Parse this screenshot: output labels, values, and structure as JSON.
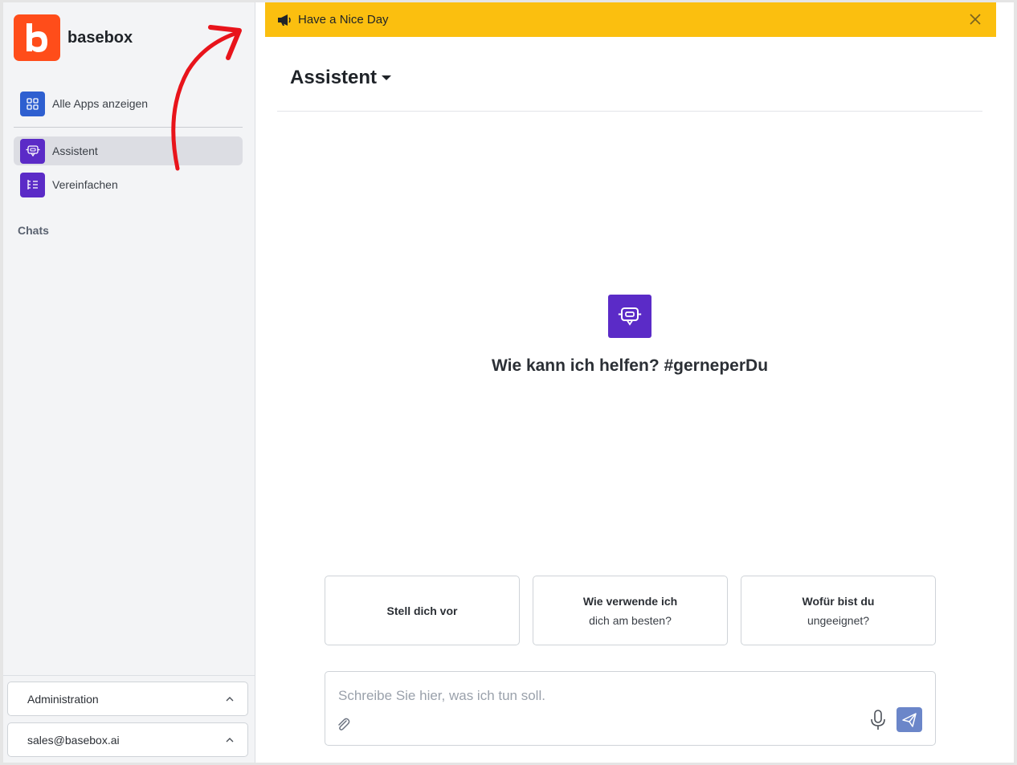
{
  "brand": {
    "name": "basebox",
    "logo_letter": "b"
  },
  "sidebar": {
    "items": [
      {
        "label": "Alle Apps anzeigen",
        "icon": "grid-icon"
      },
      {
        "label": "Assistent",
        "icon": "robot-icon",
        "active": true
      },
      {
        "label": "Vereinfachen",
        "icon": "list-indent-icon"
      }
    ],
    "chats_label": "Chats",
    "admin_label": "Administration",
    "account_label": "sales@basebox.ai"
  },
  "banner": {
    "text": "Have a Nice Day",
    "icon": "megaphone-icon"
  },
  "main": {
    "title": "Assistent",
    "help_text": "Wie kann ich helfen? #gerneperDu",
    "suggestions": [
      {
        "line1": "Stell dich vor",
        "line2": ""
      },
      {
        "line1": "Wie verwende ich",
        "line2": "dich am besten?"
      },
      {
        "line1": "Wofür bist du",
        "line2": "ungeeignet?"
      }
    ],
    "input_placeholder": "Schreibe Sie hier, was ich tun soll."
  },
  "colors": {
    "brand": "#ff4d1a",
    "banner": "#fbbf0f",
    "accent_purple": "#5b2bc7",
    "accent_blue": "#2e5fd0",
    "send_button": "#6b86c9",
    "annotation_arrow": "#e8141b"
  }
}
